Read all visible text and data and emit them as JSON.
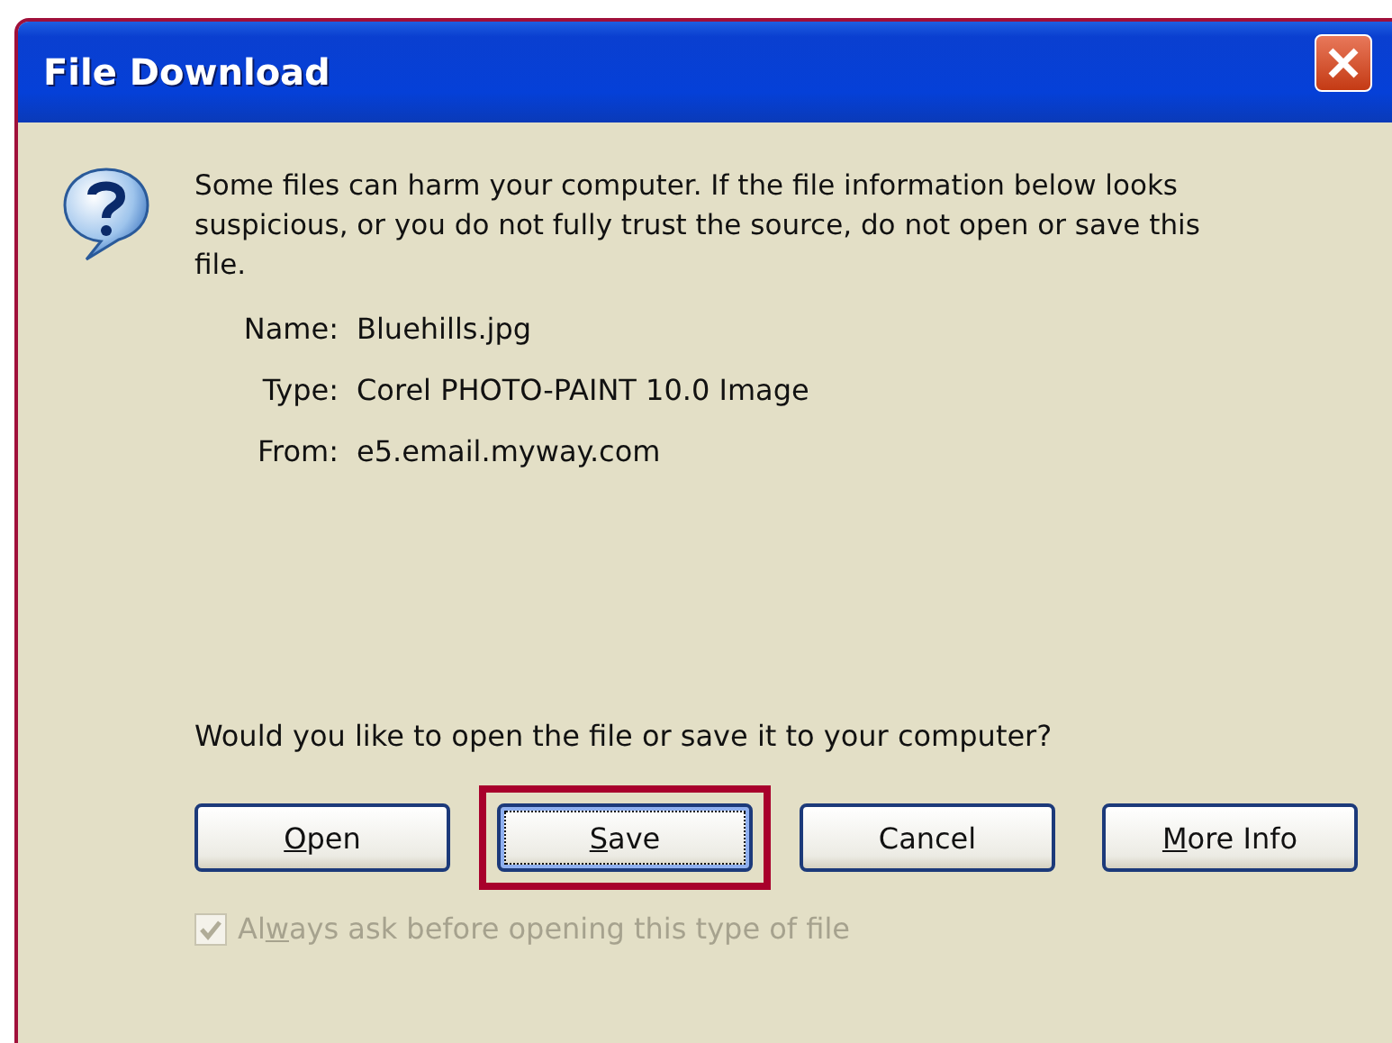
{
  "window": {
    "title": "File Download"
  },
  "message": "Some files can harm your computer. If the file information below looks suspicious, or you do not fully trust the source, do not open or save this file.",
  "file_info": [
    {
      "label": "Name:",
      "value": "Bluehills.jpg"
    },
    {
      "label": "Type:",
      "value": "Corel PHOTO-PAINT 10.0 Image"
    },
    {
      "label": "From:",
      "value": "e5.email.myway.com"
    }
  ],
  "question": "Would you like to open the file or save it to your computer?",
  "buttons": [
    {
      "key": "O",
      "after": "pen",
      "focused": false,
      "highlighted": false
    },
    {
      "key": "S",
      "after": "ave",
      "focused": true,
      "highlighted": true
    },
    {
      "before": "Cancel",
      "focused": false,
      "highlighted": false
    },
    {
      "key": "M",
      "after": "ore Info",
      "focused": false,
      "highlighted": false
    }
  ],
  "checkbox": {
    "before": "Al",
    "key": "w",
    "after": "ays ask before opening this type of file",
    "checked": true,
    "disabled": true
  }
}
